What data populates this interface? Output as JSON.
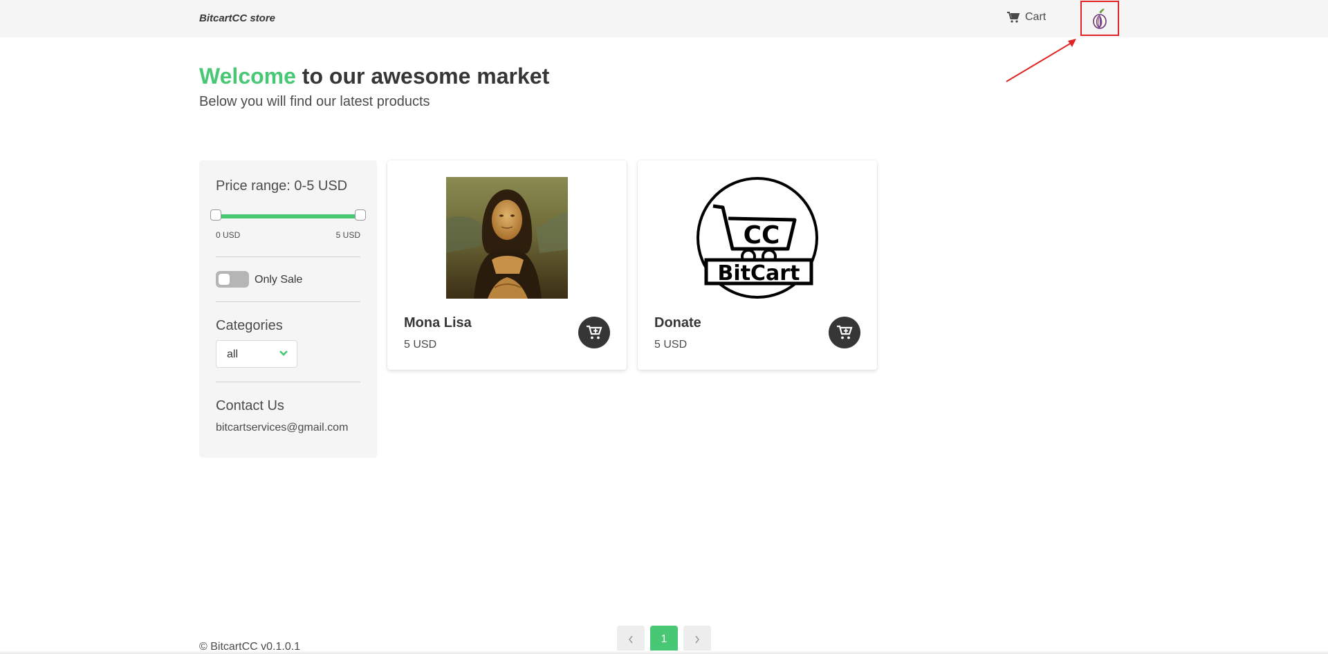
{
  "navbar": {
    "brand": "BitcartCC store",
    "cart_label": "Cart",
    "cart_icon": "shopping-cart-icon",
    "tor_icon": "tor-onion-icon"
  },
  "hero": {
    "title_accent": "Welcome",
    "title_rest": " to our awesome market",
    "subtitle": "Below you will find our latest products"
  },
  "filters": {
    "price_label": "Price range:",
    "price_value": "0-5 USD",
    "range_min": "0 USD",
    "range_max": "5 USD",
    "only_sale_label": "Only Sale",
    "only_sale_on": false,
    "categories_title": "Categories",
    "category_selected": "all",
    "contact_title": "Contact Us",
    "contact_email": "bitcartservices@gmail.com"
  },
  "products": [
    {
      "name": "Mona Lisa",
      "price": "5 USD",
      "image": "mona-lisa-painting"
    },
    {
      "name": "Donate",
      "price": "5 USD",
      "image": "bitcart-logo",
      "logo_cc": "CC",
      "logo_text": "BitCart"
    }
  ],
  "pagination": {
    "current_page": "1"
  },
  "footer": {
    "text": "© BitcartCC v0.1.0.1"
  },
  "colors": {
    "accent": "#48c774",
    "dark": "#363636",
    "annotation": "#e02424"
  }
}
